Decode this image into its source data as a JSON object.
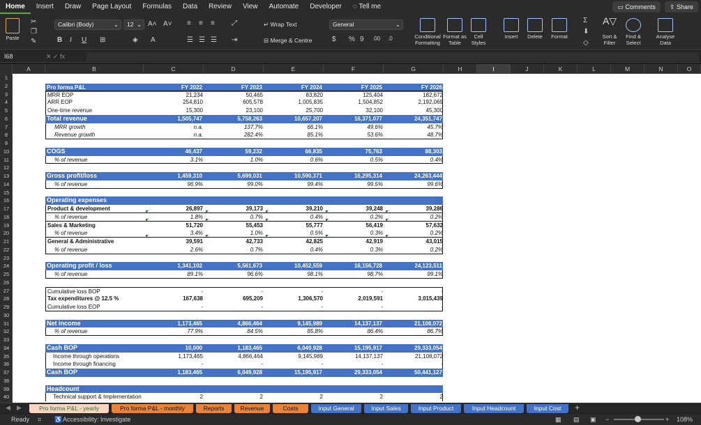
{
  "menu": {
    "items": [
      "Home",
      "Insert",
      "Draw",
      "Page Layout",
      "Formulas",
      "Data",
      "Review",
      "View",
      "Automate",
      "Developer",
      "Tell me"
    ],
    "comments": "Comments",
    "share": "Share"
  },
  "ribbon": {
    "paste": "Paste",
    "font_name": "Calibri (Body)",
    "font_size": "12",
    "wrap_text": "Wrap Text",
    "merge_center": "Merge & Centre",
    "number_format": "General",
    "conditional": "Conditional Formatting",
    "format_table": "Format as Table",
    "cell_styles": "Cell Styles",
    "insert": "Insert",
    "delete": "Delete",
    "format": "Format",
    "sort_filter": "Sort & Filter",
    "find_select": "Find & Select",
    "analyse": "Analyse Data"
  },
  "formula_bar": {
    "name_box": "I68",
    "fx": "fx",
    "content": ""
  },
  "columns": [
    "A",
    "B",
    "C",
    "D",
    "E",
    "F",
    "G",
    "H",
    "I",
    "J",
    "K",
    "L",
    "M",
    "N",
    "O"
  ],
  "selected_column": "I",
  "sheet": {
    "headers": [
      "Pro forma P&L",
      "FY 2022",
      "FY 2023",
      "FY 2024",
      "FY 2025",
      "FY 2026"
    ],
    "rows": [
      {
        "r": 3,
        "label": "MRR EOP",
        "vals": [
          "21,234",
          "50,465",
          "83,820",
          "125,404",
          "182,672"
        ]
      },
      {
        "r": 4,
        "label": "ARR EOP",
        "vals": [
          "254,810",
          "605,578",
          "1,005,835",
          "1,504,852",
          "2,192,069"
        ]
      },
      {
        "r": 5,
        "label": "One-time revenue",
        "vals": [
          "15,300",
          "23,100",
          "25,700",
          "32,100",
          "45,300"
        ]
      },
      {
        "r": 6,
        "label": "Total revenue",
        "vals": [
          "1,505,747",
          "5,758,263",
          "10,657,207",
          "16,371,077",
          "24,351,747"
        ]
      },
      {
        "r": 7,
        "label": "MRR growth",
        "vals": [
          "n.a.",
          "137.7%",
          "66.1%",
          "49.6%",
          "45.7%"
        ]
      },
      {
        "r": 8,
        "label": "Revenue growth",
        "vals": [
          "n.a.",
          "282.4%",
          "85.1%",
          "53.6%",
          "48.7%"
        ]
      },
      {
        "r": 10,
        "label": "COGS",
        "vals": [
          "46,437",
          "59,232",
          "66,835",
          "75,763",
          "88,303"
        ]
      },
      {
        "r": 11,
        "label": "% of revenue",
        "vals": [
          "3.1%",
          "1.0%",
          "0.6%",
          "0.5%",
          "0.4%"
        ]
      },
      {
        "r": 13,
        "label": "Gross profit/loss",
        "vals": [
          "1,459,310",
          "5,699,031",
          "10,590,371",
          "16,295,314",
          "24,263,444"
        ]
      },
      {
        "r": 14,
        "label": "% of revenue",
        "vals": [
          "96.9%",
          "99.0%",
          "99.4%",
          "99.5%",
          "99.6%"
        ]
      },
      {
        "r": 16,
        "label": "Operating expenses",
        "vals": [
          "",
          "",
          "",
          "",
          ""
        ]
      },
      {
        "r": 17,
        "label": "Product & development",
        "vals": [
          "26,897",
          "39,173",
          "39,210",
          "39,248",
          "39,286"
        ]
      },
      {
        "r": 18,
        "label": "% of revenue",
        "vals": [
          "1.8%",
          "0.7%",
          "0.4%",
          "0.2%",
          "0.2%"
        ]
      },
      {
        "r": 19,
        "label": "Sales & Marketing",
        "vals": [
          "51,720",
          "55,453",
          "55,777",
          "56,419",
          "57,632"
        ]
      },
      {
        "r": 20,
        "label": "% of revenue",
        "vals": [
          "3.4%",
          "1.0%",
          "0.5%",
          "0.3%",
          "0.2%"
        ]
      },
      {
        "r": 21,
        "label": "General & Administrative",
        "vals": [
          "39,591",
          "42,733",
          "42,825",
          "42,919",
          "43,015"
        ]
      },
      {
        "r": 22,
        "label": "% of revenue",
        "vals": [
          "2.6%",
          "0.7%",
          "0.4%",
          "0.3%",
          "0.2%"
        ]
      },
      {
        "r": 24,
        "label": "Operating profit / loss",
        "vals": [
          "1,341,102",
          "5,561,673",
          "10,452,559",
          "16,156,728",
          "24,123,511"
        ]
      },
      {
        "r": 25,
        "label": "% of revenue",
        "vals": [
          "89.1%",
          "96.6%",
          "98.1%",
          "98.7%",
          "99.1%"
        ]
      },
      {
        "r": 27,
        "label": "Cumulative loss BOP",
        "vals": [
          "-",
          "-",
          "-",
          "-",
          "-"
        ]
      },
      {
        "r": 28,
        "label": "Tax expenditures @ 12.5 %",
        "vals": [
          "167,638",
          "695,209",
          "1,306,570",
          "2,019,591",
          "3,015,439"
        ]
      },
      {
        "r": 29,
        "label": "Cumulative loss EOP",
        "vals": [
          "-",
          "-",
          "-",
          "-",
          "-"
        ]
      },
      {
        "r": 31,
        "label": "Net income",
        "vals": [
          "1,173,465",
          "4,866,464",
          "9,145,989",
          "14,137,137",
          "21,108,072"
        ]
      },
      {
        "r": 32,
        "label": "% of revenue",
        "vals": [
          "77.9%",
          "84.5%",
          "85.8%",
          "86.4%",
          "86.7%"
        ]
      },
      {
        "r": 34,
        "label": "Cash BOP",
        "vals": [
          "10,000",
          "1,183,465",
          "6,049,928",
          "15,195,917",
          "29,333,054"
        ]
      },
      {
        "r": 35,
        "label": "Income through operations",
        "vals": [
          "1,173,465",
          "4,866,464",
          "9,145,989",
          "14,137,137",
          "21,108,072"
        ]
      },
      {
        "r": 36,
        "label": "Income through financing",
        "vals": [
          "-",
          "-",
          "-",
          "-",
          "-"
        ]
      },
      {
        "r": 37,
        "label": "Cash BOP",
        "vals": [
          "1,183,465",
          "6,049,928",
          "15,195,917",
          "29,333,054",
          "50,441,127"
        ]
      },
      {
        "r": 39,
        "label": "Headcount",
        "vals": [
          "",
          "",
          "",
          "",
          ""
        ]
      },
      {
        "r": 40,
        "label": "Technical support & Implementation",
        "vals": [
          "2",
          "2",
          "2",
          "2",
          "2"
        ]
      }
    ]
  },
  "tabs": [
    {
      "label": "Pro forma P&L - yearly",
      "style": "active"
    },
    {
      "label": "Pro forma P&L - monthly",
      "style": "orange"
    },
    {
      "label": "Reports",
      "style": "orange"
    },
    {
      "label": "Revenue",
      "style": "orange"
    },
    {
      "label": "Costs",
      "style": "orange"
    },
    {
      "label": "Input General",
      "style": "blue"
    },
    {
      "label": "Input Sales",
      "style": "blue"
    },
    {
      "label": "Input Product",
      "style": "blue"
    },
    {
      "label": "Input Headcount",
      "style": "blue"
    },
    {
      "label": "Input Cost",
      "style": "blue"
    }
  ],
  "status": {
    "ready": "Ready",
    "accessibility": "Accessibility: Investigate",
    "zoom": "108%"
  },
  "colors": {
    "header_blue": "#4472c4",
    "tab_orange": "#e8833a",
    "tab_active": "#f6d5c3"
  }
}
